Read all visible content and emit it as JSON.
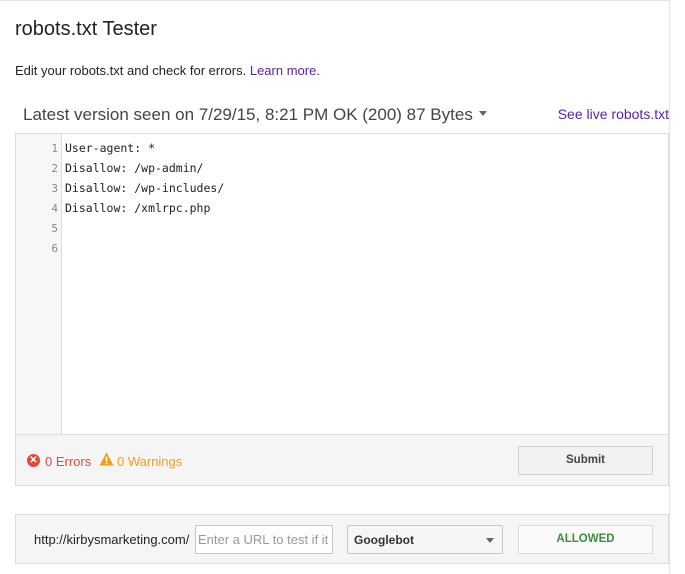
{
  "header": {
    "title": "robots.txt Tester",
    "intro": "Edit your robots.txt and check for errors.",
    "learn_more": "Learn more."
  },
  "version_bar": {
    "label": "Latest version seen on 7/29/15, 8:21 PM OK (200) 87 Bytes",
    "see_live": "See live robots.txt"
  },
  "editor": {
    "line_numbers": [
      "1",
      "2",
      "3",
      "4",
      "5",
      "6"
    ],
    "lines": [
      "User-agent: *",
      "Disallow: /wp-admin/",
      "Disallow: /wp-includes/",
      "Disallow: /xmlrpc.php",
      "",
      ""
    ]
  },
  "status": {
    "errors": "0 Errors",
    "warnings": "0 Warnings",
    "submit_label": "Submit",
    "error_color": "#dd4b39",
    "warning_color": "#f39c12"
  },
  "test": {
    "url_prefix": "http://kirbysmarketing.com/",
    "url_placeholder": "Enter a URL to test if it is blocked",
    "user_agent": "Googlebot",
    "result": "ALLOWED",
    "result_color": "#3a8c3a"
  },
  "colors": {
    "link": "#5a1fa6"
  }
}
